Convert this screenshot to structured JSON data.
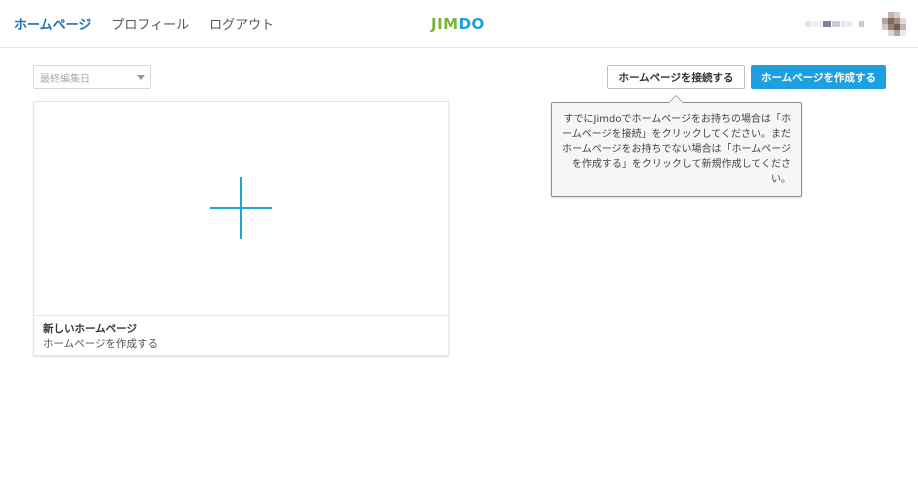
{
  "nav": {
    "items": [
      {
        "label": "ホームページ",
        "active": true
      },
      {
        "label": "プロフィール",
        "active": false
      },
      {
        "label": "ログアウト",
        "active": false
      }
    ]
  },
  "logo": {
    "part1": "JIM",
    "part2": "DO",
    "colors": {
      "green": "#79b43a",
      "blue": "#17a3d9"
    }
  },
  "toolbar": {
    "sort_value": "最終編集日",
    "connect_label": "ホームページを接続する",
    "create_label": "ホームページを作成する"
  },
  "tooltip": {
    "text": "すでにJimdoでホームページをお持ちの場合は「ホームページを接続」をクリックしてください。まだホームページをお持ちでない場合は「ホームページを作成する」をクリックして新規作成してください。"
  },
  "card": {
    "title": "新しいホームページ",
    "subtitle": "ホームページを作成する",
    "icon": "plus-icon"
  },
  "colors": {
    "accent": "#1e9fde",
    "nav_active": "#1f6fb5"
  }
}
